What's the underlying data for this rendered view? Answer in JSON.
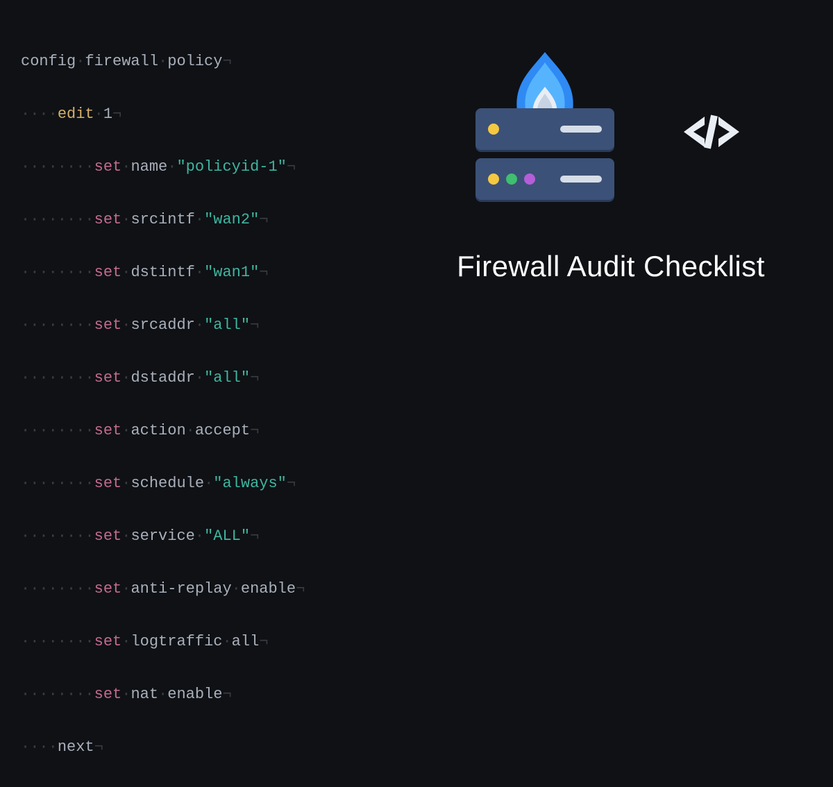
{
  "title": "Firewall Audit Checklist",
  "colors": {
    "bg": "#0f1115",
    "dim": "#3a3d44",
    "edit": "#d4b06a",
    "set": "#c36b8e",
    "attr": "#a9b0bb",
    "str": "#3fb5a0"
  },
  "code": {
    "l1_a": "config",
    "l1_b": "firewall",
    "l1_c": "policy",
    "l2_kw": "edit",
    "l2_val": "1",
    "l3_kw": "set",
    "l3_attr": "name",
    "l3_str": "\"policyid-1\"",
    "l4_kw": "set",
    "l4_attr": "srcintf",
    "l4_str": "\"wan2\"",
    "l5_kw": "set",
    "l5_attr": "dstintf",
    "l5_str": "\"wan1\"",
    "l6_kw": "set",
    "l6_attr": "srcaddr",
    "l6_str": "\"all\"",
    "l7_kw": "set",
    "l7_attr": "dstaddr",
    "l7_str": "\"all\"",
    "l8_kw": "set",
    "l8_attr": "action",
    "l8_val": "accept",
    "l9_kw": "set",
    "l9_attr": "schedule",
    "l9_str": "\"always\"",
    "l10_kw": "set",
    "l10_attr": "service",
    "l10_str": "\"ALL\"",
    "l11_kw": "set",
    "l11_attr": "anti-replay",
    "l11_val": "enable",
    "l12_kw": "set",
    "l12_attr": "logtraffic",
    "l12_val": "all",
    "l13_kw": "set",
    "l13_attr": "nat",
    "l13_val": "enable",
    "l14_kw": "next"
  },
  "whitespace": {
    "dot": "·",
    "para": "¬",
    "indent1": "····",
    "indent2": "········"
  },
  "icons": {
    "server": "firewall-server-flame-icon",
    "code": "code-brackets-icon"
  }
}
